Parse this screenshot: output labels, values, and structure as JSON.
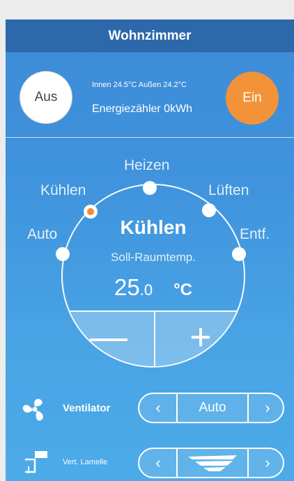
{
  "header": {
    "title": "Wohnzimmer"
  },
  "power": {
    "off_label": "Aus",
    "on_label": "Ein"
  },
  "status": {
    "temps": "Innen 24.5°C Außen 24.2°C",
    "energy": "Energiezähler 0kWh"
  },
  "modes": {
    "heat": "Heizen",
    "cool": "Kühlen",
    "fan": "Lüften",
    "auto": "Auto",
    "dry": "Entf.",
    "active": "cool"
  },
  "thermostat": {
    "mode_title": "Kühlen",
    "setpoint_label": "Soll-Raumtemp.",
    "temp_int": "25",
    "temp_dec": ".0",
    "unit": "°C",
    "minus": "—",
    "plus": "+"
  },
  "ventilator": {
    "label": "Ventilator",
    "value": "Auto",
    "prev": "‹",
    "next": "›",
    "icon": "fan-icon"
  },
  "louver": {
    "label": "Vert. Lamelle",
    "prev": "‹",
    "next": "›",
    "icon": "louver-icon"
  },
  "colors": {
    "header": "#2d68aa",
    "accent": "#f2933a",
    "background": "#4298de"
  }
}
